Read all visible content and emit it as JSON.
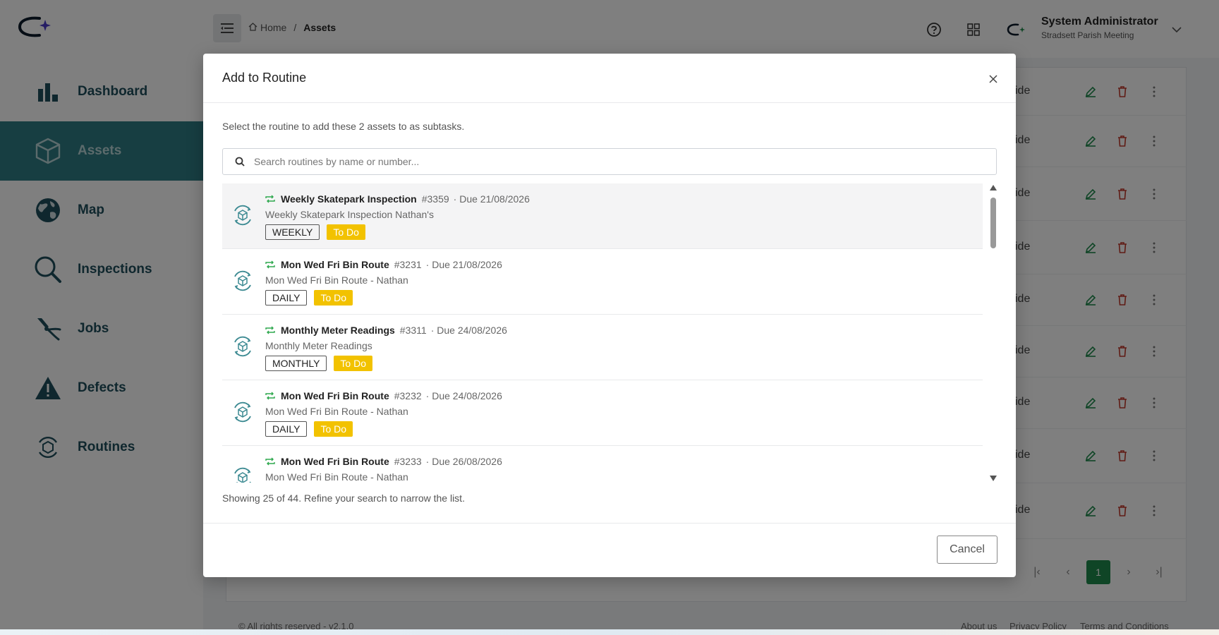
{
  "sidebar": {
    "items": [
      {
        "label": "Dashboard",
        "icon": "bar-chart-icon"
      },
      {
        "label": "Assets",
        "icon": "cube-icon",
        "active": true
      },
      {
        "label": "Map",
        "icon": "globe-icon"
      },
      {
        "label": "Inspections",
        "icon": "magnifier-icon"
      },
      {
        "label": "Jobs",
        "icon": "pliers-icon"
      },
      {
        "label": "Defects",
        "icon": "warning-icon"
      },
      {
        "label": "Routines",
        "icon": "routine-cycle-icon"
      }
    ]
  },
  "header": {
    "breadcrumb": {
      "home": "Home",
      "separator": "/",
      "current": "Assets"
    },
    "user": {
      "name": "System Administrator",
      "org": "Stradsett Parish Meeting"
    }
  },
  "background_table": {
    "row_text": "ide",
    "pagination": {
      "current_page": "1"
    }
  },
  "footer": {
    "copyright": "© All rights reserved - v2.1.0",
    "links": [
      "About us",
      "Privacy Policy",
      "Terms and Conditions"
    ]
  },
  "modal": {
    "title": "Add to Routine",
    "description": "Select the routine to add these 2 assets to as subtasks.",
    "search_placeholder": "Search routines by name or number...",
    "routines": [
      {
        "name": "Weekly Skatepark Inspection",
        "number": "#3359",
        "due": "· Due 21/08/2026",
        "description": "Weekly Skatepark Inspection Nathan's",
        "frequency": "WEEKLY",
        "status": "To Do"
      },
      {
        "name": "Mon Wed Fri Bin Route",
        "number": "#3231",
        "due": "· Due 21/08/2026",
        "description": "Mon Wed Fri Bin Route - Nathan",
        "frequency": "DAILY",
        "status": "To Do"
      },
      {
        "name": "Monthly Meter Readings",
        "number": "#3311",
        "due": "· Due 24/08/2026",
        "description": "Monthly Meter Readings",
        "frequency": "MONTHLY",
        "status": "To Do"
      },
      {
        "name": "Mon Wed Fri Bin Route",
        "number": "#3232",
        "due": "· Due 24/08/2026",
        "description": "Mon Wed Fri Bin Route - Nathan",
        "frequency": "DAILY",
        "status": "To Do"
      },
      {
        "name": "Mon Wed Fri Bin Route",
        "number": "#3233",
        "due": "· Due 26/08/2026",
        "description": "Mon Wed Fri Bin Route - Nathan",
        "frequency": "",
        "status": ""
      }
    ],
    "showing_text": "Showing 25 of 44. Refine your search to narrow the list.",
    "cancel_label": "Cancel"
  },
  "colors": {
    "brand_teal": "#2f7c84",
    "status_todo": "#f2c200",
    "repeat_green": "#2fa84f",
    "pager_green": "#1f8a4c"
  }
}
